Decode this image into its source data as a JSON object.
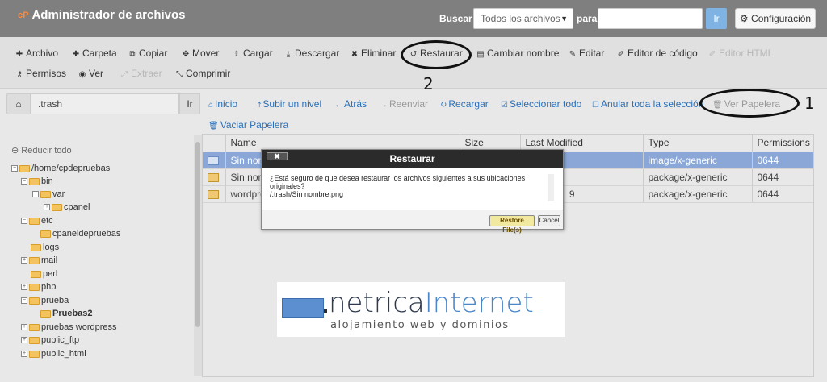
{
  "header": {
    "logo": "cP",
    "title": "Administrador de archivos",
    "search_label": "Buscar",
    "search_scope": "Todos los archivos",
    "para_label": "para",
    "search_value": "",
    "go_label": "Ir",
    "config_label": "Configuración"
  },
  "toolbar": {
    "row1": [
      {
        "label": "Archivo",
        "icon": "plus-icon"
      },
      {
        "label": "Carpeta",
        "icon": "plus-icon"
      },
      {
        "label": "Copiar",
        "icon": "copy-icon"
      },
      {
        "label": "Mover",
        "icon": "move-icon"
      },
      {
        "label": "Cargar",
        "icon": "upload-icon"
      },
      {
        "label": "Descargar",
        "icon": "download-icon"
      },
      {
        "label": "Eliminar",
        "icon": "close-icon"
      },
      {
        "label": "Restaurar",
        "icon": "undo-icon"
      },
      {
        "label": "Cambiar nombre",
        "icon": "file-icon"
      },
      {
        "label": "Editar",
        "icon": "pencil-icon"
      },
      {
        "label": "Editor de código",
        "icon": "edit-square-icon"
      },
      {
        "label": "Editor HTML",
        "icon": "edit-square-icon"
      }
    ],
    "row2": [
      {
        "label": "Permisos",
        "icon": "key-icon"
      },
      {
        "label": "Ver",
        "icon": "eye-icon"
      },
      {
        "label": "Extraer",
        "icon": "expand-icon"
      },
      {
        "label": "Comprimir",
        "icon": "compress-icon"
      }
    ]
  },
  "path": {
    "value": ".trash",
    "go_label": "Ir"
  },
  "tree": {
    "collapse_label": "Reducir todo",
    "items": [
      "/home/cpdepruebas",
      "bin",
      "var",
      "cpanel",
      "etc",
      "cpaneldepruebas",
      "logs",
      "mail",
      "perl",
      "php",
      "prueba",
      "Pruebas2",
      "pruebas wordpress",
      "public_ftp",
      "public_html"
    ]
  },
  "nav": {
    "home": "Inicio",
    "up": "Subir un nivel",
    "back": "Atrás",
    "forward": "Reenviar",
    "reload": "Recargar",
    "select_all": "Seleccionar todo",
    "unselect_all": "Anular toda la selección",
    "view_trash": "Ver Papelera",
    "empty_trash": "Vaciar Papelera"
  },
  "table": {
    "columns": [
      "Name",
      "Size",
      "Last Modified",
      "Type",
      "Permissions"
    ],
    "rows": [
      {
        "name": "Sin nomb",
        "size": "",
        "modified": "",
        "type": "image/x-generic",
        "perms": "0644"
      },
      {
        "name": "Sin nom",
        "size": "",
        "modified": "",
        "type": "package/x-generic",
        "perms": "0644"
      },
      {
        "name": "wordpre",
        "size": "",
        "modified": "9",
        "type": "package/x-generic",
        "perms": "0644"
      }
    ]
  },
  "modal": {
    "title": "Restaurar",
    "close_label": "✖",
    "message": "¿Está seguro de que desea restaurar los archivos siguientes a sus ubicaciones originales?",
    "file": "/.trash/Sin nombre.png",
    "confirm_label": "Restore File(s)",
    "cancel_label": "Cancel"
  },
  "annotations": {
    "step1": "1",
    "step2": "2"
  },
  "watermark": {
    "name_part1": "netrica",
    "name_part2": "Internet",
    "tagline": "alojamiento web y dominios"
  },
  "colors": {
    "header_bg": "#7f7f7f",
    "link_blue": "#2a6fb8",
    "selected_row": "#8aa7d8",
    "cpanel_orange": "#ff8a3d"
  }
}
